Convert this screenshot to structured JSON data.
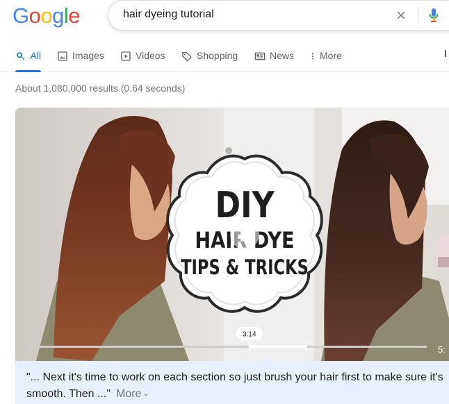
{
  "logo": {
    "letters": [
      "G",
      "o",
      "o",
      "g",
      "l",
      "e"
    ],
    "colors": [
      "#4285F4",
      "#EA4335",
      "#FBBC05",
      "#4285F4",
      "#34A853",
      "#EA4335"
    ]
  },
  "search": {
    "query": "hair dyeing tutorial"
  },
  "tabs": [
    {
      "label": "All",
      "icon": "search-icon",
      "active": true
    },
    {
      "label": "Images",
      "icon": "image-icon"
    },
    {
      "label": "Videos",
      "icon": "play-icon"
    },
    {
      "label": "Shopping",
      "icon": "tag-icon"
    },
    {
      "label": "News",
      "icon": "news-icon"
    },
    {
      "label": "More",
      "icon": "more-vert-icon"
    }
  ],
  "result_stats": "About 1,080,000 results (0.64 seconds)",
  "video": {
    "overlay_line1": "DIY",
    "overlay_line2": "HAIR DYE",
    "overlay_line3": "TIPS & TRICKS",
    "clip_start": "3:14",
    "duration_partial": "5:",
    "progress_fraction": 0.557,
    "clip_end_fraction": 0.7
  },
  "snippet": {
    "text": "\"... Next it's time to work on each section so just brush your hair first to make sure it's smooth. Then ...\"",
    "more_label": "More"
  },
  "colors": {
    "accent": "#1a73e8",
    "snippet_bg": "#e8f0fe"
  }
}
